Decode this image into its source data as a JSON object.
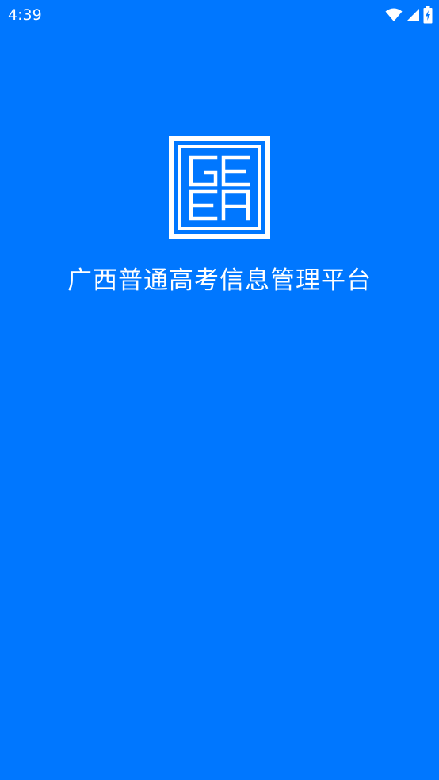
{
  "status_bar": {
    "time": "4:39",
    "icons": [
      "wifi-icon",
      "cellular-signal-icon",
      "battery-charging-icon"
    ]
  },
  "splash": {
    "logo_icon": "geea-logo-icon",
    "logo_letters": [
      "G",
      "E",
      "E",
      "A"
    ],
    "title": "广西普通高考信息管理平台"
  },
  "colors": {
    "background": "#0077FF",
    "foreground": "#FFFFFF"
  }
}
